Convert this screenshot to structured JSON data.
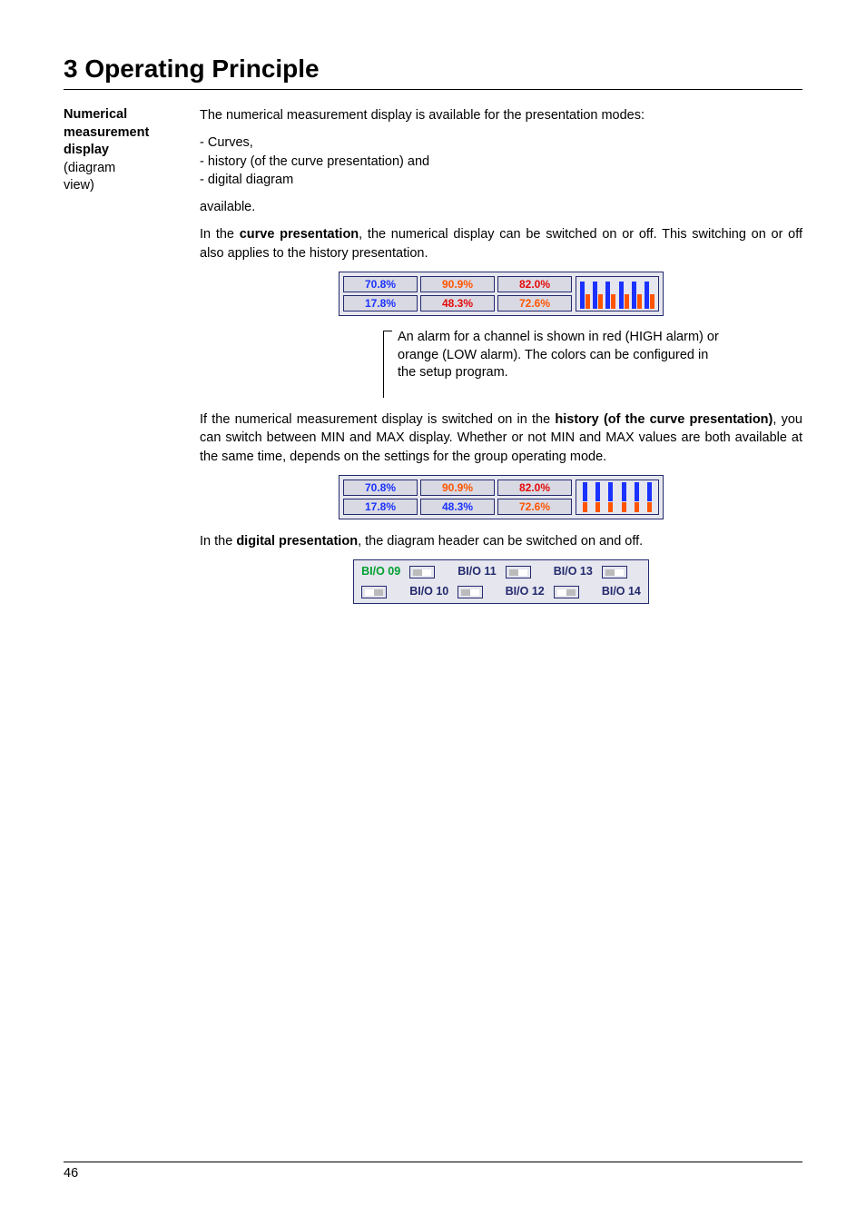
{
  "chapter_title": "3 Operating Principle",
  "margin": {
    "line1": "Numerical",
    "line2": "measurement",
    "line3": "display",
    "line4": "(diagram",
    "line5": "view)"
  },
  "p1": "The numerical measurement display is available for the presentation modes:",
  "bullets": {
    "b1": "- Curves,",
    "b2": "- history (of the curve presentation) and",
    "b3": "- digital diagram"
  },
  "p1b": "available.",
  "p2a": "In the ",
  "p2b": "curve presentation",
  "p2c": ", the numerical display can be switched on or off. This switching on or off also applies to the history presentation.",
  "fig1": {
    "r1c1": "70.8%",
    "r1c2": "90.9%",
    "r1c3": "82.0%",
    "r2c1": "17.8%",
    "r2c2": "48.3%",
    "r2c3": "72.6%"
  },
  "fig1_caption": "An alarm for a channel is shown in red (HIGH alarm) or orange (LOW alarm). The colors can be configured in the setup program.",
  "p3a": "If the numerical measurement display is switched on in the ",
  "p3b": "history (of the curve presentation)",
  "p3c": ", you can switch between MIN and MAX display. Whether or not MIN and MAX values are both available at the same time, depends on the settings for the group operating mode.",
  "fig2": {
    "r1c1": "70.8%",
    "r1c2": "90.9%",
    "r1c3": "82.0%",
    "r2c1": "17.8%",
    "r2c2": "48.3%",
    "r2c3": "72.6%"
  },
  "p4a": "In the ",
  "p4b": "digital presentation",
  "p4c": ", the diagram header can be switched on and off.",
  "fig3": {
    "c1": "BI/O 09",
    "c2": "BI/O 11",
    "c3": "BI/O 13",
    "c4": "BI/O 10",
    "c5": "BI/O 12",
    "c6": "BI/O 14"
  },
  "page_number": "46"
}
